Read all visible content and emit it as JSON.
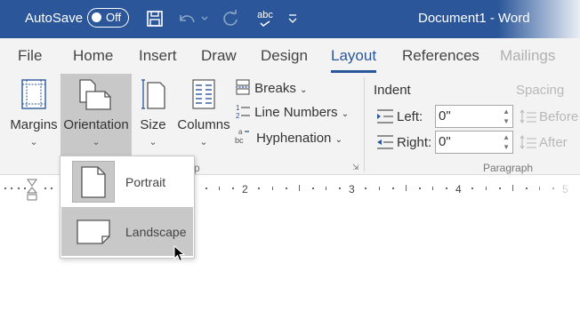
{
  "titlebar": {
    "autosave_label": "AutoSave",
    "autosave_state": "Off",
    "document_title": "Document1  -  Word",
    "icons": [
      "save-icon",
      "undo-icon",
      "redo-icon",
      "spelling-icon",
      "customize-quick-access-icon"
    ],
    "spelling_glyph": "abc"
  },
  "tabs": [
    "File",
    "Home",
    "Insert",
    "Draw",
    "Design",
    "Layout",
    "References",
    "Mailings"
  ],
  "active_tab": "Layout",
  "ribbon": {
    "page_setup": {
      "margins": "Margins",
      "orientation": "Orientation",
      "size": "Size",
      "columns": "Columns",
      "breaks": "Breaks",
      "line_numbers": "Line Numbers",
      "hyphenation": "Hyphenation",
      "group_label_visible": "p"
    },
    "paragraph": {
      "indent_heading": "Indent",
      "spacing_heading": "Spacing",
      "left_label": "Left:",
      "left_value": "0\"",
      "right_label": "Right:",
      "right_value": "0\"",
      "before_label": "Before",
      "after_label": "After",
      "group_label": "Paragraph"
    }
  },
  "ruler": {
    "numbers": [
      "2",
      "3",
      "4",
      "5"
    ]
  },
  "orientation_menu": {
    "items": [
      {
        "label": "Portrait",
        "selected": true
      },
      {
        "label": "Landscape",
        "hovered": true
      }
    ]
  },
  "colors": {
    "title_bar": "#2b579a",
    "ribbon_bg": "#f3f3f3",
    "accent": "#2b579a",
    "selected_bg": "#c8c8c8"
  }
}
